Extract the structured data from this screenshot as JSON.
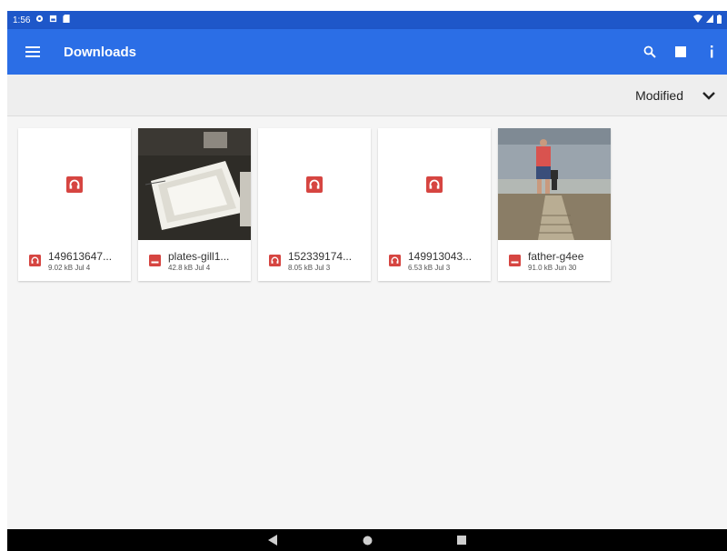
{
  "status_bar": {
    "time": "1:56",
    "left_icons": [
      "settings-gear-icon",
      "gallery-icon",
      "sd-card-icon"
    ],
    "right_icons": [
      "wifi-icon",
      "signal-icon",
      "battery-icon"
    ]
  },
  "app_bar": {
    "title": "Downloads",
    "menu_icon": "hamburger-menu-icon",
    "actions": [
      "search-icon",
      "grid-view-icon",
      "more-info-icon"
    ],
    "color": "#2b6ee6"
  },
  "sort": {
    "label": "Modified",
    "toggle_icon": "chevron-down-icon"
  },
  "files": [
    {
      "name": "149613647...",
      "meta": "9.02 kB Jul 4",
      "type": "audio",
      "thumb": "audio-icon"
    },
    {
      "name": "plates-gill1...",
      "meta": "42.8 kB Jul 4",
      "type": "image",
      "thumb": "plates-photo"
    },
    {
      "name": "152339174...",
      "meta": "8.05 kB Jul 3",
      "type": "audio",
      "thumb": "audio-icon"
    },
    {
      "name": "149913043...",
      "meta": "6.53 kB Jul 3",
      "type": "audio",
      "thumb": "audio-icon"
    },
    {
      "name": "father-g4ee",
      "meta": "91.0 kB Jun 30",
      "type": "image",
      "thumb": "father-son-photo"
    }
  ],
  "colors": {
    "status_bar": "#1e57c9",
    "file_icon_red": "#d64541",
    "background": "#f5f5f5"
  },
  "nav_bar": {
    "buttons": [
      "back-icon",
      "home-icon",
      "recents-icon"
    ]
  }
}
